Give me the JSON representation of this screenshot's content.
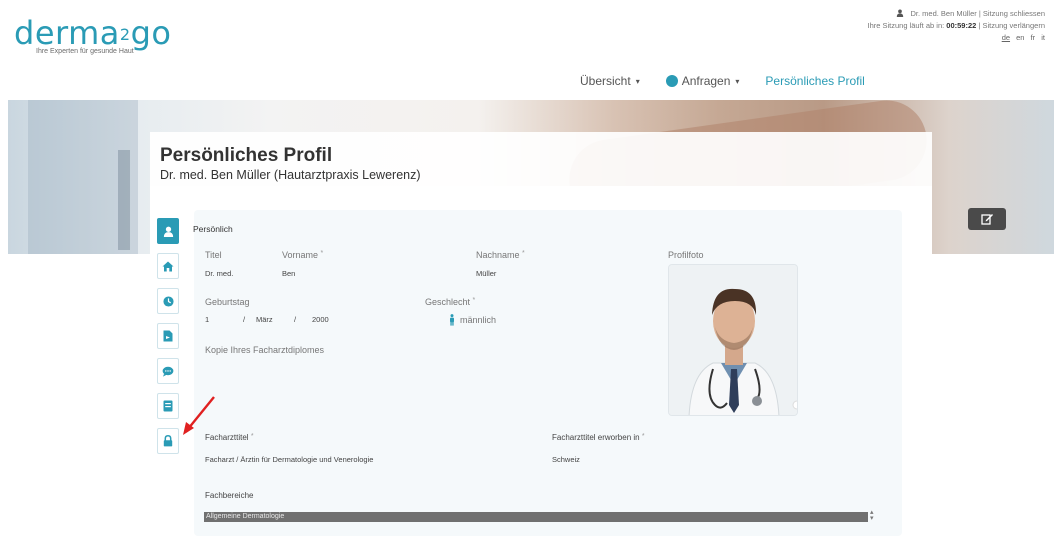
{
  "brand": {
    "logo_prefix": "derma",
    "logo_sup": "2",
    "logo_suffix": "go",
    "tagline": "Ihre Experten für gesunde Haut",
    "accent_color": "#2a9bb5"
  },
  "session": {
    "user_line": "Dr. med. Ben Müller | Sitzung schliessen",
    "timer_prefix": "Ihre Sitzung läuft ab in:",
    "timer_value": "00:59:22",
    "timer_suffix": "| Sitzung verlängern",
    "languages": [
      "de",
      "en",
      "fr",
      "it"
    ],
    "active_language": "de"
  },
  "nav": {
    "items": [
      {
        "label": "Übersicht",
        "dropdown": true
      },
      {
        "label": "Anfragen",
        "dropdown": true
      },
      {
        "label": "Persönliches Profil",
        "dropdown": false
      }
    ]
  },
  "page": {
    "title": "Persönliches Profil",
    "subtitle": "Dr. med. Ben Müller (Hautarztpraxis Lewerenz)"
  },
  "sidebar": {
    "icons": [
      "user-icon",
      "home-icon",
      "clock-icon",
      "file-icon",
      "chat-icon",
      "book-icon",
      "lock-icon"
    ],
    "active_index": 0
  },
  "profile": {
    "section_label": "Persönlich",
    "title_label": "Titel",
    "title_value": "Dr. med.",
    "firstname_label": "Vorname",
    "firstname_value": "Ben",
    "lastname_label": "Nachname",
    "lastname_value": "Müller",
    "photo_label": "Profilfoto",
    "birthday_label": "Geburtstag",
    "birthday_day": "1",
    "birthday_month": "März",
    "birthday_year": "2000",
    "date_separator": "/",
    "gender_label": "Geschlecht",
    "gender_value": "männlich",
    "diploma_label": "Kopie Ihres Facharztdiplomes",
    "specialist_title_label": "Facharzttitel",
    "specialist_title_value": "Facharzt / Ärztin für Dermatologie und Venerologie",
    "specialist_country_label": "Facharzttitel erworben in",
    "specialist_country_value": "Schweiz",
    "fields_label": "Fachbereiche",
    "fields_value": "Allgemeine Dermatologie",
    "required_mark": "*"
  },
  "colors": {
    "accent": "#2a9bb5",
    "annotation_arrow": "#e02020",
    "edit_button": "#4a4a4a"
  }
}
